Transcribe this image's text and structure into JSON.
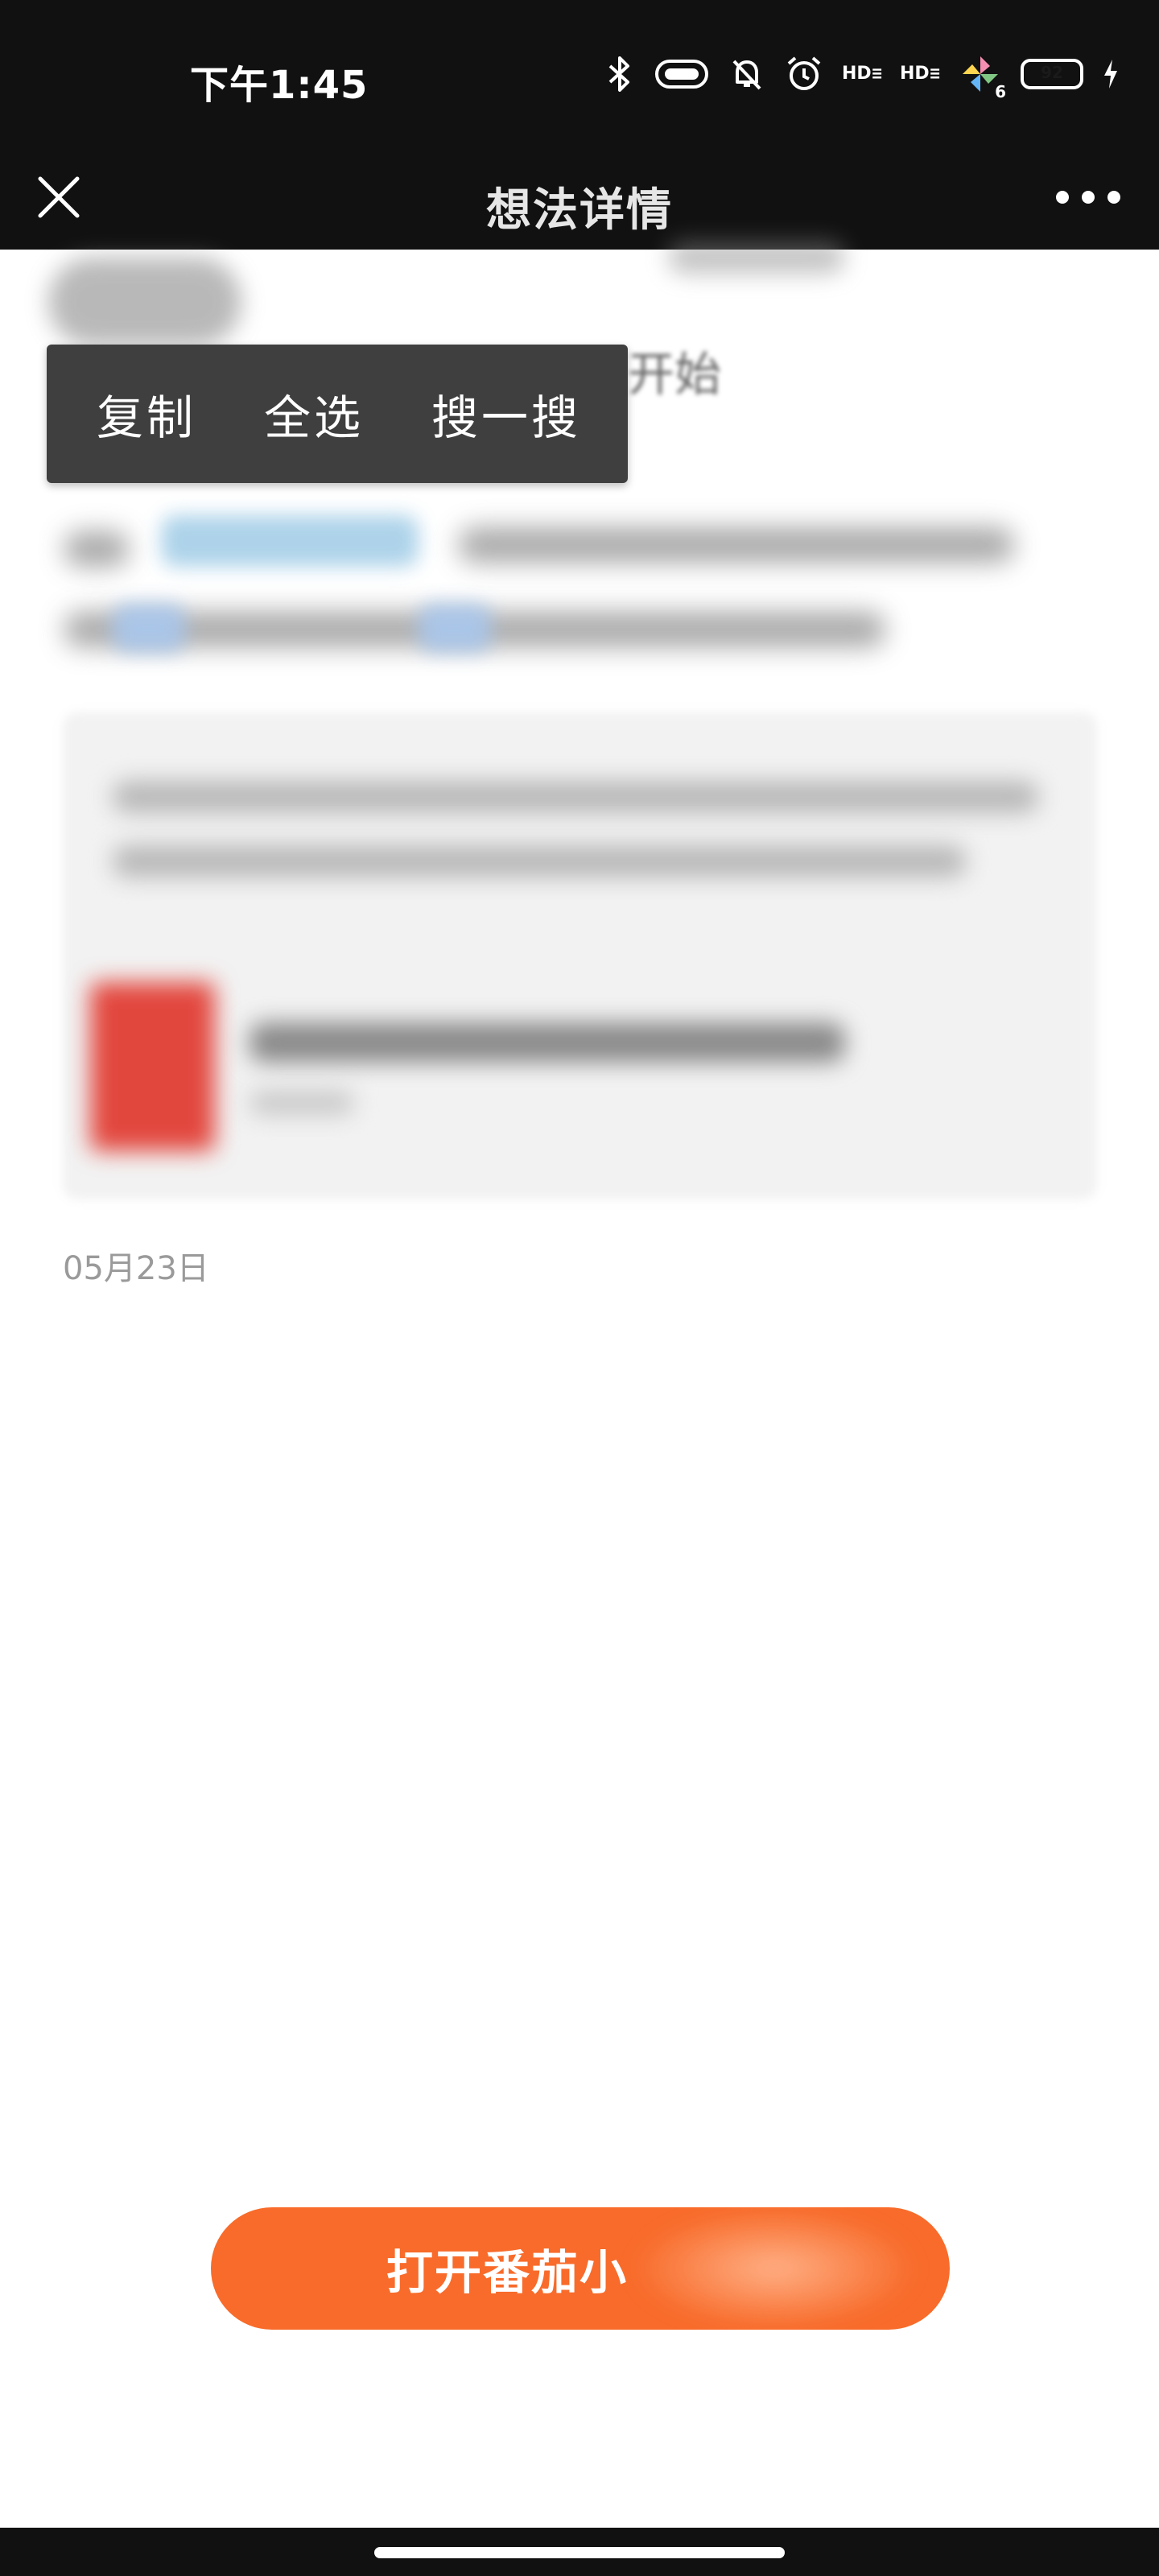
{
  "status_bar": {
    "time": "下午1:45",
    "battery_level": "92",
    "network_badge": "6",
    "hd_label_1": "HD",
    "hd_label_2": "HD"
  },
  "nav": {
    "title": "想法详情",
    "close_icon": "close-icon",
    "more_icon": "more-icon"
  },
  "selection_menu": {
    "items": [
      "复制",
      "全选",
      "搜一搜"
    ],
    "peek_text": "开始"
  },
  "post": {
    "date": "05月23日"
  },
  "cta": {
    "label": "打开番茄小",
    "accent_color": "#f86b2a"
  },
  "colors": {
    "bar_bg": "#111111",
    "popup_bg": "#3f3f3f",
    "highlight": "#9fcbe6"
  }
}
